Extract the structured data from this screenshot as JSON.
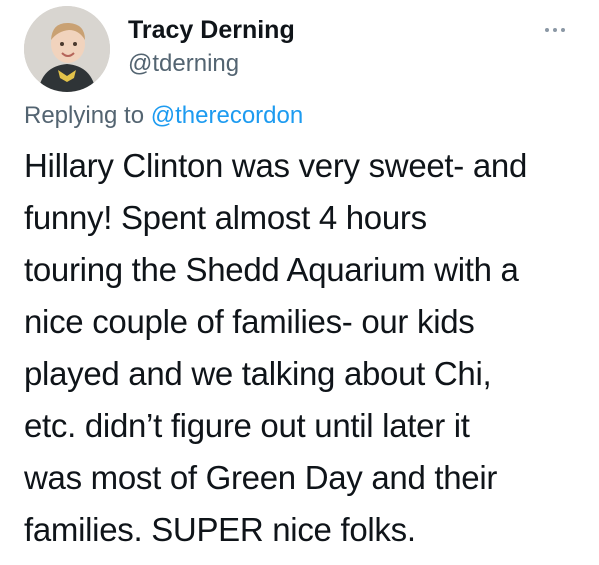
{
  "tweet": {
    "display_name": "Tracy Derning",
    "handle": "@tderning",
    "reply_prefix": "Replying to ",
    "reply_to": "@therecordon",
    "body_lines": [
      "Hillary Clinton was very sweet- and",
      "funny! Spent almost 4 hours",
      "touring the Shedd Aquarium with a",
      "nice couple of families- our kids",
      "played and we talking about Chi,",
      "etc. didn’t figure out until later it",
      "was most of Green Day and their",
      "families. SUPER nice folks."
    ]
  },
  "icons": {
    "more": "more-options-icon"
  },
  "colors": {
    "text": "#0f1419",
    "secondary": "#536471",
    "link": "#1d9bf0"
  }
}
